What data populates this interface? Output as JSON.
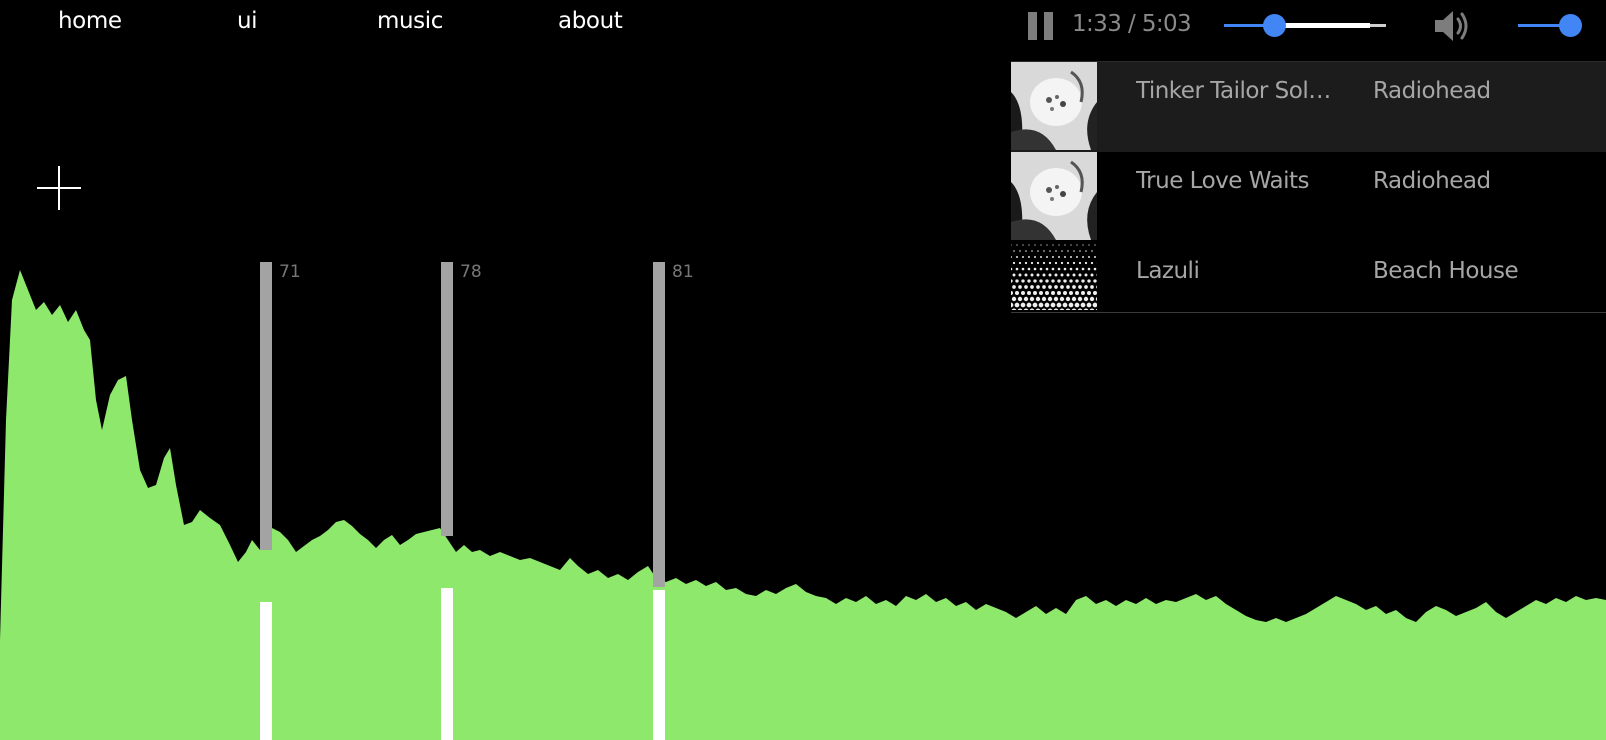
{
  "nav": {
    "items": [
      {
        "label": "home"
      },
      {
        "label": "ui"
      },
      {
        "label": "music"
      },
      {
        "label": "about"
      }
    ]
  },
  "player": {
    "state": "playing",
    "time_display": "1:33 / 5:03",
    "seek_fraction": 0.307,
    "buffered_fraction": 0.9,
    "volume_fraction": 1.0,
    "accent_color": "#4285f4"
  },
  "playlist": [
    {
      "title": "Tinker Tailor Sold...",
      "artist": "Radiohead",
      "art": "moon-shaped-pool",
      "active": true
    },
    {
      "title": "True Love Waits",
      "artist": "Radiohead",
      "art": "moon-shaped-pool",
      "active": false
    },
    {
      "title": "Lazuli",
      "artist": "Beach House",
      "art": "dot-pattern",
      "active": false
    }
  ],
  "markers": [
    {
      "value": "71"
    },
    {
      "value": "78"
    },
    {
      "value": "81"
    }
  ],
  "visualizer": {
    "fill_color": "#8ee86c"
  },
  "icons": {
    "add": "plus-icon",
    "pause": "pause-icon",
    "volume": "speaker-icon"
  }
}
